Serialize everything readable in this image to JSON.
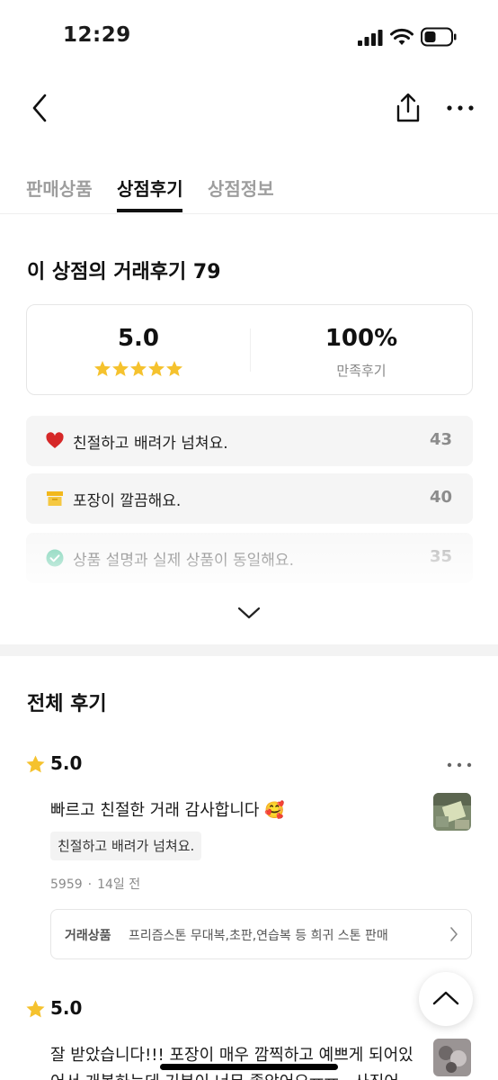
{
  "status_bar": {
    "time": "12:29"
  },
  "tabs": [
    {
      "label": "판매상품",
      "active": false
    },
    {
      "label": "상점후기",
      "active": true
    },
    {
      "label": "상점정보",
      "active": false
    }
  ],
  "summary": {
    "title": "이 상점의 거래후기 79",
    "score": "5.0",
    "stars": 5,
    "satisfaction": "100%",
    "satisfaction_label": "만족후기"
  },
  "keywords": [
    {
      "icon": "heart-icon",
      "text": "친절하고 배려가 넘쳐요.",
      "count": "43",
      "color": "#e02b2b"
    },
    {
      "icon": "box-icon",
      "text": "포장이 깔끔해요.",
      "count": "40",
      "color": "#f5c22e"
    },
    {
      "icon": "check-circle-icon",
      "text": "상품 설명과 실제 상품이 동일해요.",
      "count": "35",
      "color": "#2fb88a"
    }
  ],
  "all_reviews": {
    "title": "전체 후기",
    "items": [
      {
        "score": "5.0",
        "text": "빠르고 친절한 거래 감사합니다 🥰",
        "tag": "친절하고 배려가 넘쳐요.",
        "author": "5959",
        "time": "14일 전",
        "product_label": "거래상품",
        "product_name": "프리즘스톤 무대복,초판,연습복 등 희귀 스톤 판매"
      },
      {
        "score": "5.0",
        "text_line1": "잘 받았습니다!!! 포장이 매우 깜찍하고 예쁘게 되어있",
        "text_line2": "어서 개봉하는데 기분이 너무 좋았어요ㅠㅠ.. 사진어"
      }
    ]
  },
  "colors": {
    "star": "#f5c22e",
    "accent_text": "#111111",
    "muted": "#9e9e9e"
  }
}
